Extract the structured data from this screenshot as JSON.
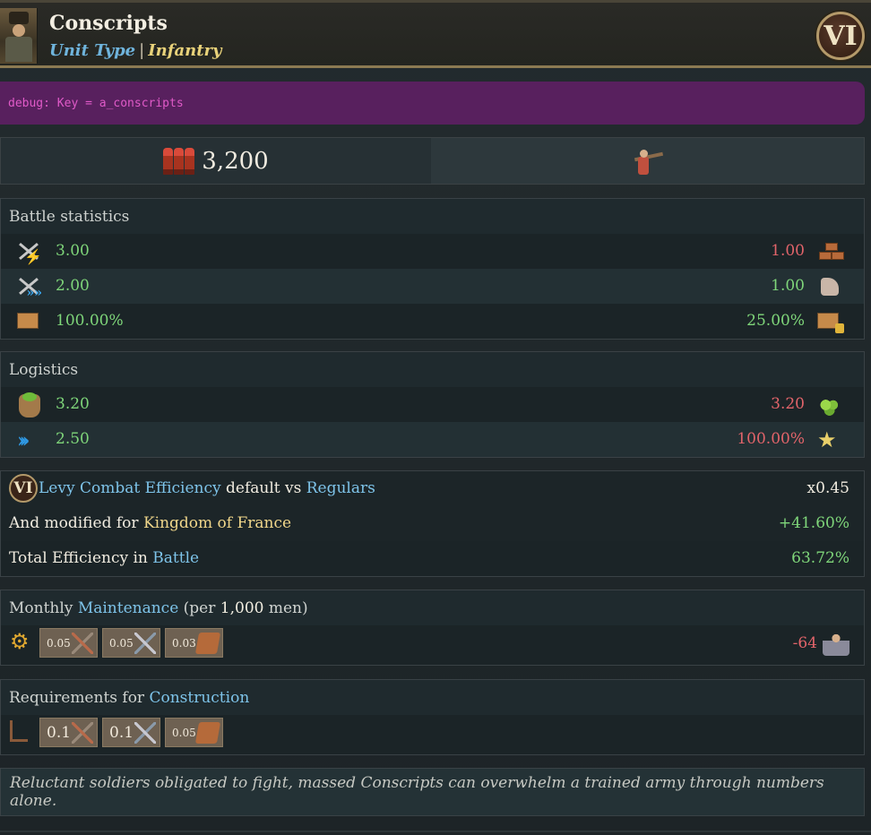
{
  "header": {
    "title": "Conscripts",
    "unit_type_label": "Unit Type",
    "separator": "|",
    "unit_category": "Infantry",
    "tier": "VI"
  },
  "debug": {
    "text": "debug: Key = a_conscripts"
  },
  "summary": {
    "men_count": "3,200"
  },
  "battle": {
    "heading": "Battle statistics",
    "rows": [
      {
        "left_icon": "attack-lightning-icon",
        "left": "3.00",
        "right": "1.00",
        "right_icon": "bricks-icon",
        "right_color": "red"
      },
      {
        "left_icon": "attack-speed-icon",
        "left": "2.00",
        "right": "1.00",
        "right_icon": "boot-wing-icon",
        "right_color": "green"
      },
      {
        "left_icon": "supply-box-icon",
        "left": "100.00%",
        "right": "25.00%",
        "right_icon": "box-lock-icon",
        "right_color": "green"
      }
    ]
  },
  "logistics": {
    "heading": "Logistics",
    "rows": [
      {
        "left_icon": "food-sack-icon",
        "left": "3.20",
        "right": "3.20",
        "right_icon": "food-pile-icon"
      },
      {
        "left_icon": "movement-chevrons-icon",
        "left": "2.50",
        "right": "100.00%",
        "right_icon": "star-icon"
      }
    ]
  },
  "efficiency": {
    "badge": "VI",
    "line1": {
      "hl1": "Levy Combat Efficiency",
      "mid": " default vs ",
      "hl2": "Regulars",
      "value": "x0.45"
    },
    "line2": {
      "pre": "And modified for ",
      "gold": "Kingdom of France",
      "value": "+41.60%"
    },
    "line3": {
      "pre": "Total Efficiency in ",
      "hl": "Battle",
      "value": "63.72%"
    }
  },
  "maintenance": {
    "pre": "Monthly ",
    "hl": "Maintenance",
    "mid": " (per ",
    "num": "1,000",
    "post": " men)",
    "chips": [
      "0.05",
      "0.05",
      "0.03"
    ],
    "manpower": "-64"
  },
  "construction": {
    "pre": "Requirements for ",
    "hl": "Construction",
    "chips": [
      "0.1",
      "0.1",
      "0.05"
    ]
  },
  "description": "Reluctant soldiers obligated to fight, massed Conscripts can overwhelm a trained army through numbers alone."
}
